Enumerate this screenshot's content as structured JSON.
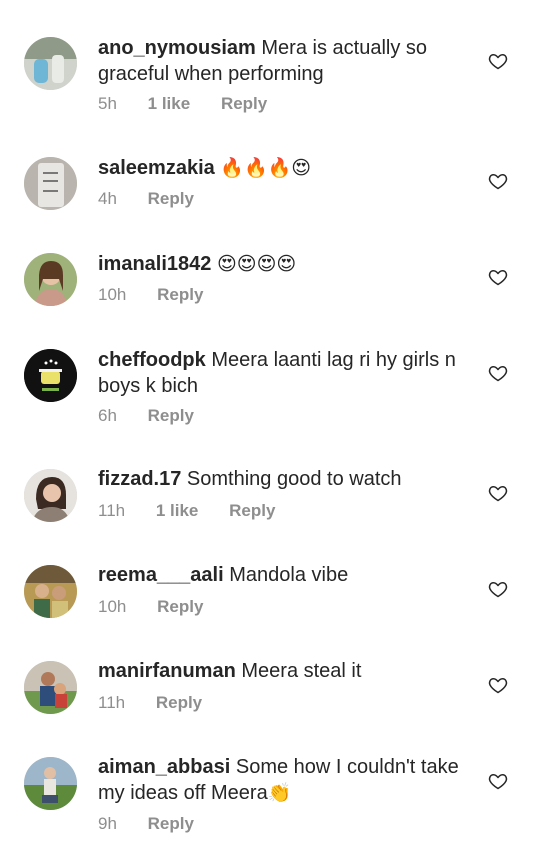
{
  "comments": [
    {
      "username": "ano_nymousiam",
      "text": "Mera is actually so graceful when performing",
      "emoji": "",
      "time": "5h",
      "likes": "1 like",
      "reply": "Reply"
    },
    {
      "username": "saleemzakia",
      "text": "",
      "emoji": "🔥🔥🔥😍",
      "time": "4h",
      "likes": "",
      "reply": "Reply"
    },
    {
      "username": "imanali1842",
      "text": "",
      "emoji": "😍😍😍😍",
      "time": "10h",
      "likes": "",
      "reply": "Reply"
    },
    {
      "username": "cheffoodpk",
      "text": "Meera laanti lag ri hy girls n boys k bich",
      "emoji": "",
      "time": "6h",
      "likes": "",
      "reply": "Reply"
    },
    {
      "username": "fizzad.17",
      "text": "Somthing good to watch",
      "emoji": "",
      "time": "11h",
      "likes": "1 like",
      "reply": "Reply"
    },
    {
      "username": "reema___aali",
      "text": "Mandola vibe",
      "emoji": "",
      "time": "10h",
      "likes": "",
      "reply": "Reply"
    },
    {
      "username": "manirfanuman",
      "text": "Meera steal it",
      "emoji": "",
      "time": "11h",
      "likes": "",
      "reply": "Reply"
    },
    {
      "username": "aiman_abbasi",
      "text": "Some how I couldn't take my ideas off Meera",
      "emoji": "👏",
      "time": "9h",
      "likes": "",
      "reply": "Reply"
    }
  ],
  "icons": {
    "like": "heart-outline-icon"
  },
  "colors": {
    "text": "#262626",
    "secondary": "#8e8e8e",
    "background": "#ffffff"
  }
}
